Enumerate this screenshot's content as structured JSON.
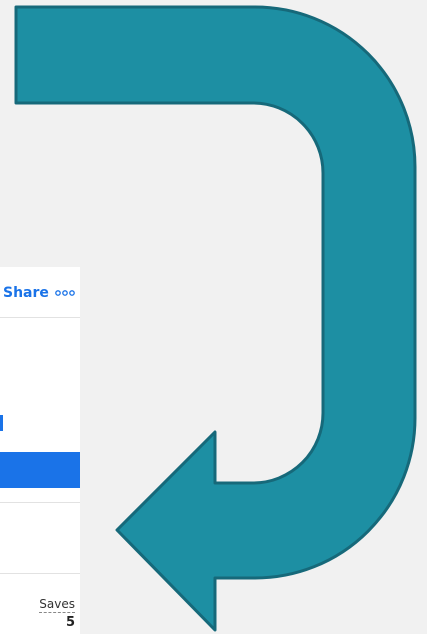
{
  "toolbar": {
    "share_label": "Share",
    "more_icon": "more-options-icon"
  },
  "stats": {
    "saves_label": "Saves",
    "saves_value": "5"
  },
  "overlay": {
    "icon": "curved-arrow-icon",
    "fill_color": "#1d8fa3",
    "stroke_color": "#16697a"
  },
  "colors": {
    "accent": "#1a73e8",
    "background": "#f1f1f1"
  }
}
